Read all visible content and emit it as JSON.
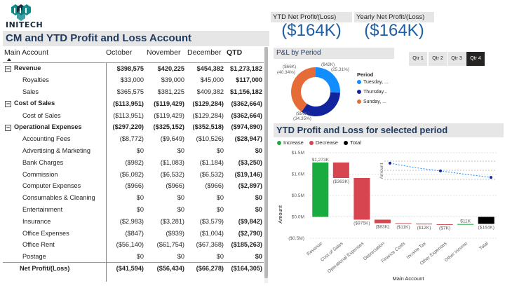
{
  "logo": {
    "name": "INITECH"
  },
  "pl_table": {
    "title": "CM and YTD Profit and Loss Account",
    "headers": [
      "Main Account",
      "October",
      "November",
      "December",
      "QTD"
    ],
    "rows": [
      {
        "type": "group",
        "label": "Revenue",
        "oct": "$398,575",
        "nov": "$420,225",
        "dec": "$454,382",
        "qtd": "$1,273,182"
      },
      {
        "type": "sub",
        "label": "Royalties",
        "oct": "$33,000",
        "nov": "$39,000",
        "dec": "$45,000",
        "qtd": "$117,000"
      },
      {
        "type": "sub",
        "label": "Sales",
        "oct": "$365,575",
        "nov": "$381,225",
        "dec": "$409,382",
        "qtd": "$1,156,182"
      },
      {
        "type": "group",
        "label": "Cost of Sales",
        "oct": "($113,951)",
        "nov": "($119,429)",
        "dec": "($129,284)",
        "qtd": "($362,664)"
      },
      {
        "type": "sub",
        "label": "Cost of Sales",
        "oct": "($113,951)",
        "nov": "($119,429)",
        "dec": "($129,284)",
        "qtd": "($362,664)"
      },
      {
        "type": "group",
        "label": "Operational Expenses",
        "oct": "($297,220)",
        "nov": "($325,152)",
        "dec": "($352,518)",
        "qtd": "($974,890)"
      },
      {
        "type": "sub",
        "label": "Accounting Fees",
        "oct": "($8,772)",
        "nov": "($9,649)",
        "dec": "($10,526)",
        "qtd": "($28,947)"
      },
      {
        "type": "sub",
        "label": "Advertising & Marketing",
        "oct": "$0",
        "nov": "$0",
        "dec": "$0",
        "qtd": "$0"
      },
      {
        "type": "sub",
        "label": "Bank Charges",
        "oct": "($982)",
        "nov": "($1,083)",
        "dec": "($1,184)",
        "qtd": "($3,250)"
      },
      {
        "type": "sub",
        "label": "Commission",
        "oct": "($6,082)",
        "nov": "($6,532)",
        "dec": "($6,532)",
        "qtd": "($19,146)"
      },
      {
        "type": "sub",
        "label": "Computer Expenses",
        "oct": "($966)",
        "nov": "($966)",
        "dec": "($966)",
        "qtd": "($2,897)"
      },
      {
        "type": "sub",
        "label": "Consumables & Cleaning",
        "oct": "$0",
        "nov": "$0",
        "dec": "$0",
        "qtd": "$0"
      },
      {
        "type": "sub",
        "label": "Entertainment",
        "oct": "$0",
        "nov": "$0",
        "dec": "$0",
        "qtd": "$0"
      },
      {
        "type": "sub",
        "label": "Insurance",
        "oct": "($2,983)",
        "nov": "($3,281)",
        "dec": "($3,579)",
        "qtd": "($9,842)"
      },
      {
        "type": "sub",
        "label": "Office Expenses",
        "oct": "($847)",
        "nov": "($939)",
        "dec": "($1,004)",
        "qtd": "($2,790)"
      },
      {
        "type": "sub",
        "label": "Office Rent",
        "oct": "($56,140)",
        "nov": "($61,754)",
        "dec": "($67,368)",
        "qtd": "($185,263)"
      },
      {
        "type": "sub",
        "label": "Postage",
        "oct": "$0",
        "nov": "$0",
        "dec": "$0",
        "qtd": "$0"
      },
      {
        "type": "total",
        "label": "Net Profit/(Loss)",
        "oct": "($41,594)",
        "nov": "($56,434)",
        "dec": "($66,278)",
        "qtd": "($164,305)"
      }
    ]
  },
  "kpis": [
    {
      "label": "YTD Net Profit/(Loss)",
      "value": "($164K)"
    },
    {
      "label": "Yearly Net Profit/(Loss)",
      "value": "($164K)"
    }
  ],
  "donut": {
    "title": "P&L by Period",
    "legend_title": "Period",
    "legend": [
      {
        "label": "Tuesday, ...",
        "color": "#118dff"
      },
      {
        "label": "Thursday...",
        "color": "#12239e"
      },
      {
        "label": "Sunday, ...",
        "color": "#e66c37"
      }
    ],
    "slices": [
      {
        "value": 42,
        "label_value": "($42K)",
        "label_pct": "(25.31%)",
        "color": "#118dff"
      },
      {
        "value": 56,
        "label_value": "($56K)",
        "label_pct": "(34.35%)",
        "color": "#12239e"
      },
      {
        "value": 66,
        "label_value": "($66K)",
        "label_pct": "(40.34%)",
        "color": "#e66c37"
      }
    ]
  },
  "quarters": {
    "options": [
      "Qtr 1",
      "Qtr 2",
      "Qtr 3",
      "Qtr 4"
    ],
    "selected": "Qtr 4"
  },
  "waterfall": {
    "title": "YTD Profit and Loss for selected period",
    "legend": [
      {
        "label": "Increase",
        "color": "#1aab40"
      },
      {
        "label": "Decrease",
        "color": "#d64550"
      },
      {
        "label": "Total",
        "color": "#000000"
      }
    ]
  },
  "chart_data": {
    "type": "bar",
    "subtype": "waterfall",
    "xlabel": "Main Account",
    "ylabel": "Amount",
    "ylim": [
      -0.5,
      1.5
    ],
    "yticks": [
      "$1.5M",
      "$1.0M",
      "$0.5M",
      "$0.0M",
      "($0.5M)"
    ],
    "categories": [
      "Revenue",
      "Cost of Sales",
      "Operational Expenses",
      "Depreciation",
      "Finance Costs",
      "Income Tax",
      "Other Expenses",
      "Other Income",
      "Total"
    ],
    "values": [
      1273,
      -363,
      -975,
      -83,
      -11,
      -12,
      -7,
      11,
      -164
    ],
    "kinds": [
      "increase",
      "decrease",
      "decrease",
      "decrease",
      "decrease",
      "decrease",
      "decrease",
      "increase",
      "total"
    ],
    "labels": [
      "$1,273K",
      "($363K)",
      "($975K)",
      "($83K)",
      "($11K)",
      "($12K)",
      "($7K)",
      "$11K",
      "($164K)"
    ],
    "inset_line": {
      "ylabel": "Amount",
      "values": [
        1.0,
        0.78,
        0.62,
        0.45,
        0.3
      ]
    }
  }
}
